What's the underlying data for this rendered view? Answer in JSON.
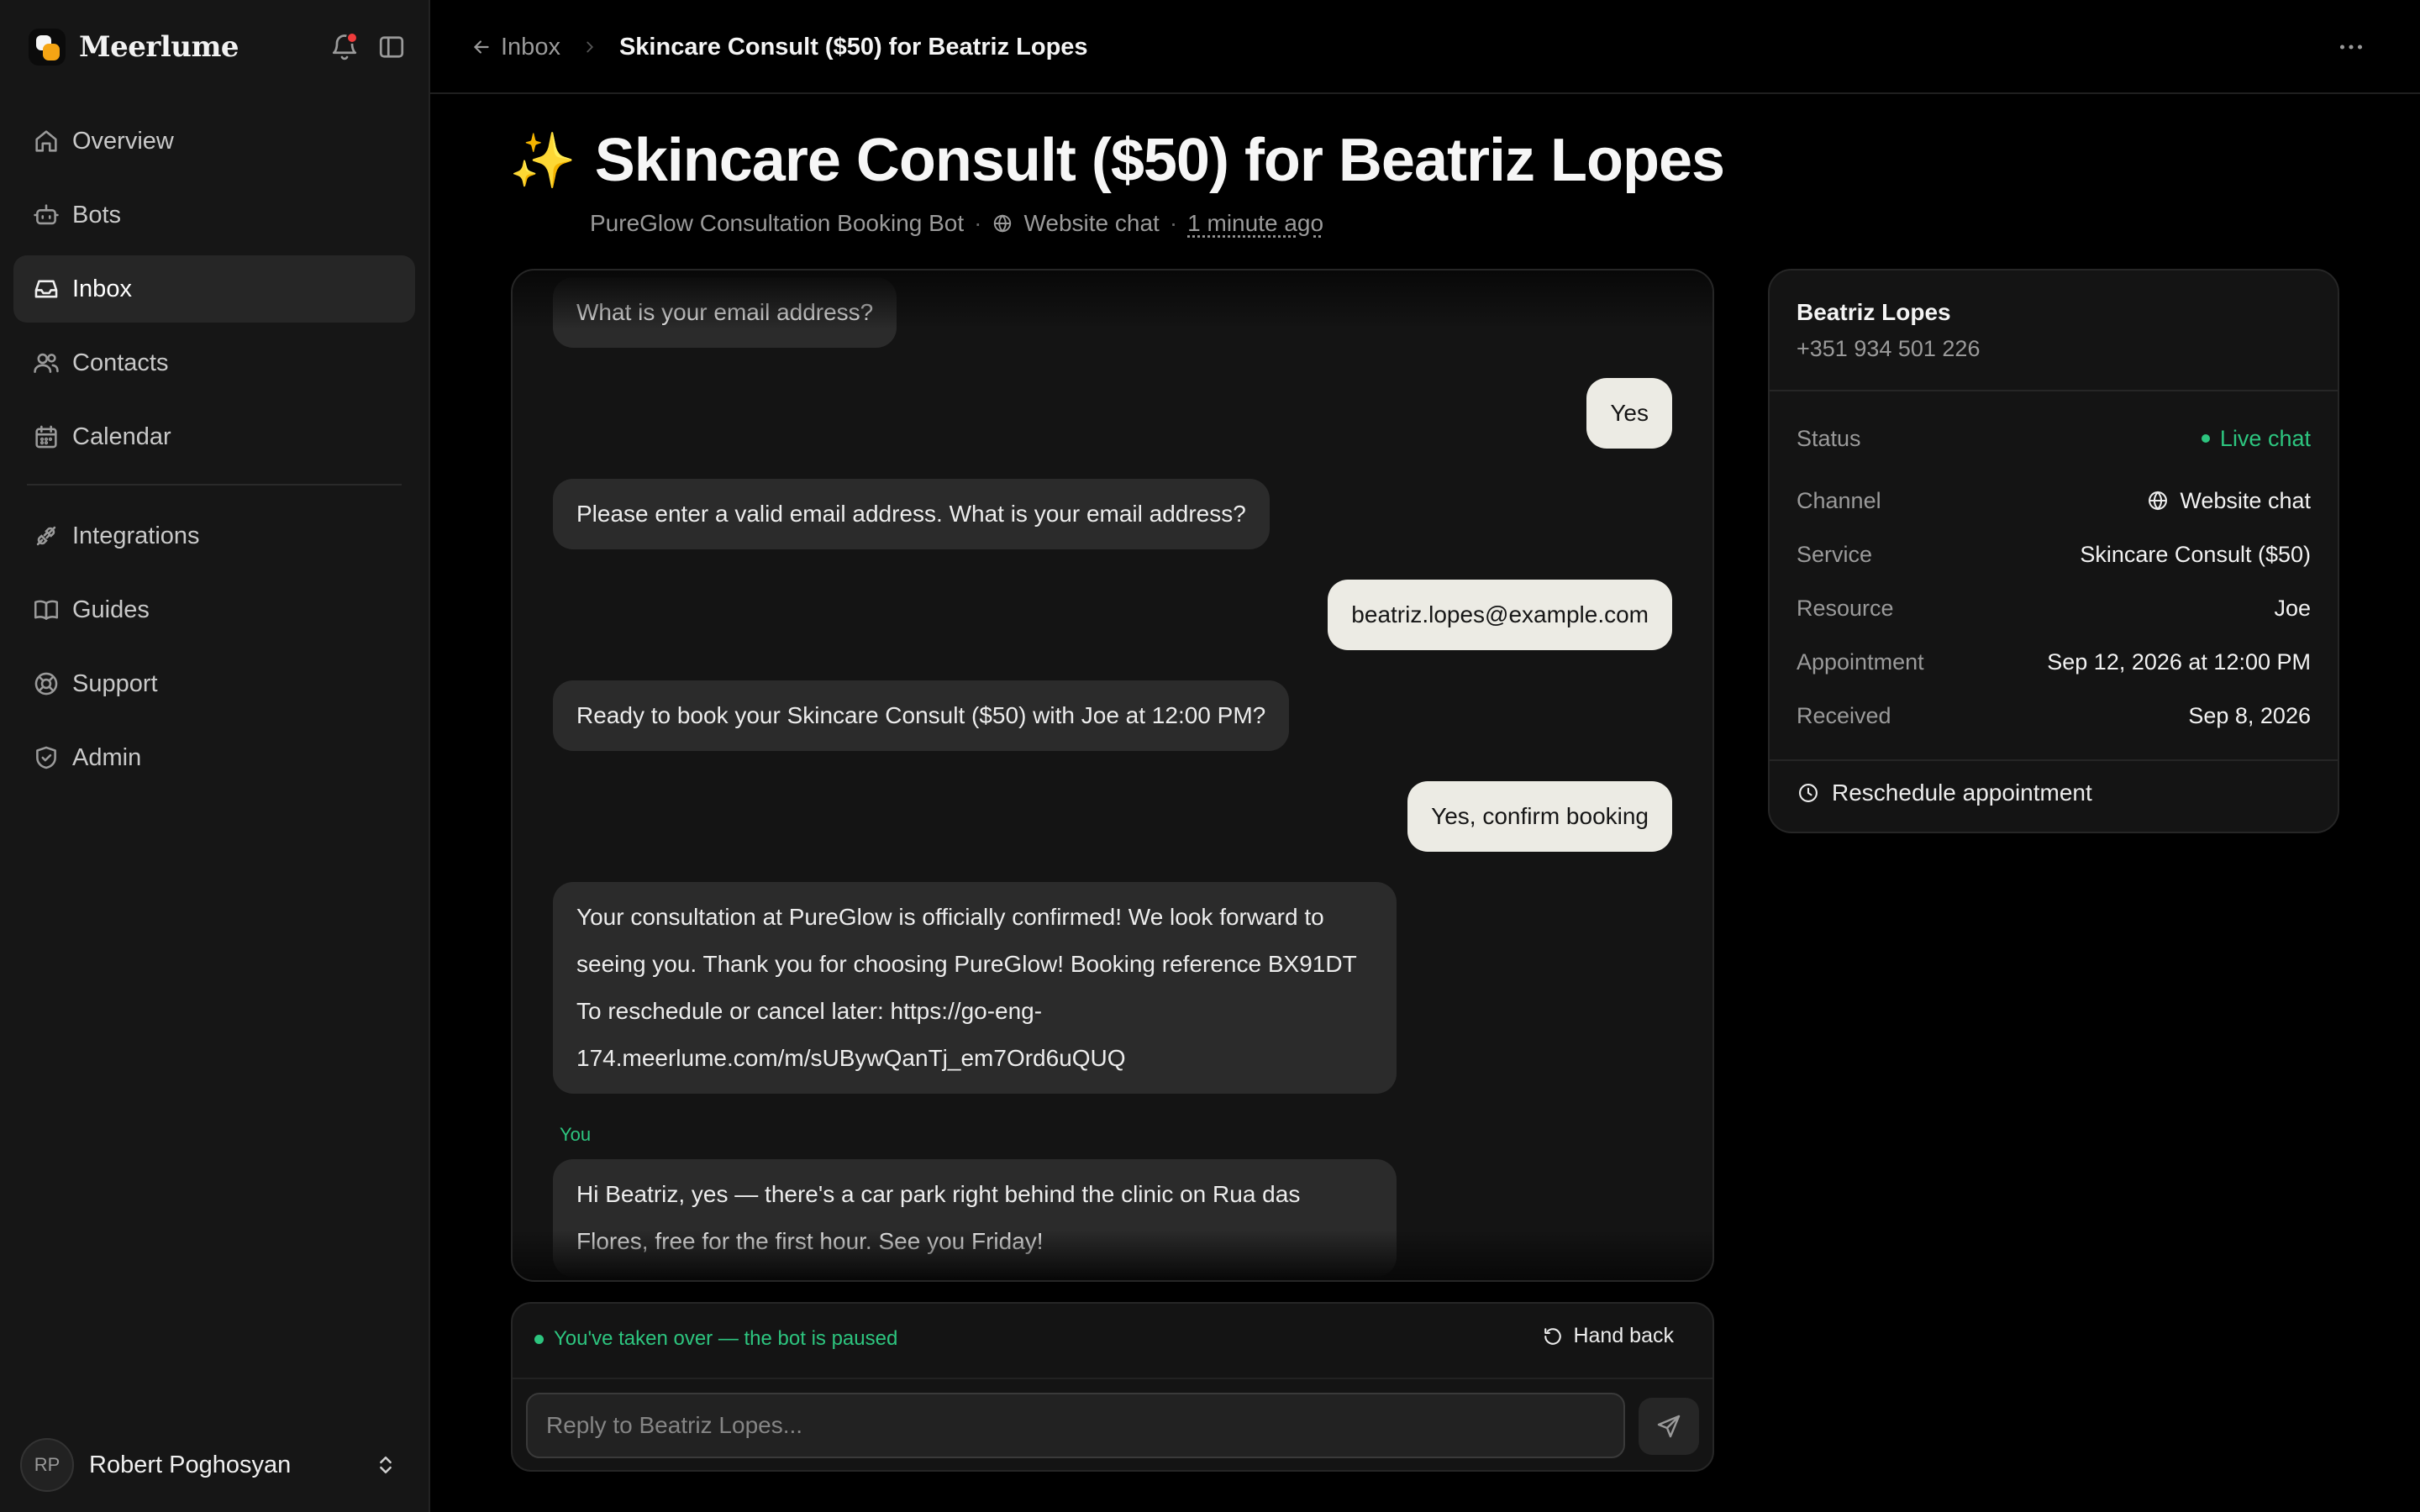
{
  "sidebar": {
    "brand": "Meerlume",
    "nav": [
      {
        "label": "Overview",
        "icon": "home-icon"
      },
      {
        "label": "Bots",
        "icon": "bot-icon"
      },
      {
        "label": "Inbox",
        "icon": "inbox-icon",
        "active": true
      },
      {
        "label": "Contacts",
        "icon": "users-icon"
      },
      {
        "label": "Calendar",
        "icon": "calendar-icon"
      },
      {
        "label": "Integrations",
        "icon": "plug-icon"
      },
      {
        "label": "Guides",
        "icon": "book-icon"
      },
      {
        "label": "Support",
        "icon": "lifebuoy-icon"
      },
      {
        "label": "Admin",
        "icon": "shield-icon"
      }
    ],
    "user": {
      "initials": "RP",
      "name": "Robert Poghosyan"
    },
    "notification_dot_color": "#ef3b3b"
  },
  "breadcrumb": {
    "back_label": "Inbox",
    "current": "Skincare Consult ($50) for Beatriz Lopes"
  },
  "header": {
    "emoji": "✨",
    "title": "Skincare Consult ($50) for Beatriz Lopes",
    "bot_name": "PureGlow Consultation Booking Bot",
    "channel": "Website chat",
    "time": "1 minute ago"
  },
  "conversation": {
    "messages": [
      {
        "role": "bot",
        "text": "What is your email address?"
      },
      {
        "role": "me",
        "text": "Yes"
      },
      {
        "role": "bot",
        "text": "Please enter a valid email address. What is your email address?"
      },
      {
        "role": "me",
        "text": "beatriz.lopes@example.com"
      },
      {
        "role": "bot",
        "text": "Ready to book your Skincare Consult ($50) with Joe at 12:00 PM?"
      },
      {
        "role": "me",
        "text": "Yes, confirm booking"
      },
      {
        "role": "bot",
        "text": "Your consultation at PureGlow is officially confirmed! We look forward to seeing you. Thank you for choosing PureGlow! Booking reference BX91DT To reschedule or cancel later: https://go-eng-174.meerlume.com/m/sUBywQanTj_em7Ord6uQUQ"
      },
      {
        "role": "agent",
        "text": "Hi Beatriz, yes — there's a car park right behind the clinic on Rua das Flores, free for the first hour. See you Friday!"
      }
    ],
    "agent_label": "You"
  },
  "composer": {
    "takeover_text": "You've taken over — the bot is paused",
    "hand_back_label": "Hand back",
    "placeholder": "Reply to Beatriz Lopes...",
    "value": ""
  },
  "contact": {
    "name": "Beatriz Lopes",
    "phone": "+351 934 501 226",
    "fields": {
      "status": {
        "label": "Status",
        "value": "Live chat"
      },
      "channel": {
        "label": "Channel",
        "value": "Website chat"
      },
      "service": {
        "label": "Service",
        "value": "Skincare Consult ($50)"
      },
      "resource": {
        "label": "Resource",
        "value": "Joe"
      },
      "appointment": {
        "label": "Appointment",
        "value": "Sep 12, 2026 at 12:00 PM"
      },
      "received": {
        "label": "Received",
        "value": "Sep 8, 2026"
      }
    },
    "reschedule_label": "Reschedule appointment"
  },
  "colors": {
    "accent_green": "#2dc57f",
    "user_bubble": "#ecebe4",
    "bot_bubble": "#2b2b2b",
    "brand_orange": "#f5a514"
  }
}
